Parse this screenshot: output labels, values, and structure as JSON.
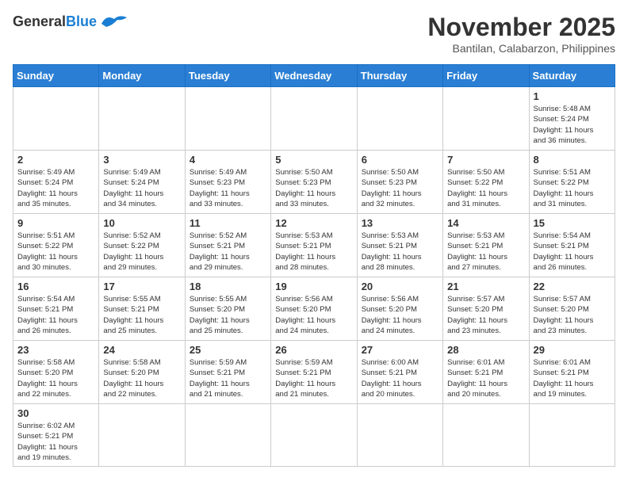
{
  "header": {
    "logo_general": "General",
    "logo_blue": "Blue",
    "month_title": "November 2025",
    "location": "Bantilan, Calabarzon, Philippines"
  },
  "days_of_week": [
    "Sunday",
    "Monday",
    "Tuesday",
    "Wednesday",
    "Thursday",
    "Friday",
    "Saturday"
  ],
  "weeks": [
    [
      {
        "day": "",
        "info": ""
      },
      {
        "day": "",
        "info": ""
      },
      {
        "day": "",
        "info": ""
      },
      {
        "day": "",
        "info": ""
      },
      {
        "day": "",
        "info": ""
      },
      {
        "day": "",
        "info": ""
      },
      {
        "day": "1",
        "info": "Sunrise: 5:48 AM\nSunset: 5:24 PM\nDaylight: 11 hours\nand 36 minutes."
      }
    ],
    [
      {
        "day": "2",
        "info": "Sunrise: 5:49 AM\nSunset: 5:24 PM\nDaylight: 11 hours\nand 35 minutes."
      },
      {
        "day": "3",
        "info": "Sunrise: 5:49 AM\nSunset: 5:24 PM\nDaylight: 11 hours\nand 34 minutes."
      },
      {
        "day": "4",
        "info": "Sunrise: 5:49 AM\nSunset: 5:23 PM\nDaylight: 11 hours\nand 33 minutes."
      },
      {
        "day": "5",
        "info": "Sunrise: 5:50 AM\nSunset: 5:23 PM\nDaylight: 11 hours\nand 33 minutes."
      },
      {
        "day": "6",
        "info": "Sunrise: 5:50 AM\nSunset: 5:23 PM\nDaylight: 11 hours\nand 32 minutes."
      },
      {
        "day": "7",
        "info": "Sunrise: 5:50 AM\nSunset: 5:22 PM\nDaylight: 11 hours\nand 31 minutes."
      },
      {
        "day": "8",
        "info": "Sunrise: 5:51 AM\nSunset: 5:22 PM\nDaylight: 11 hours\nand 31 minutes."
      }
    ],
    [
      {
        "day": "9",
        "info": "Sunrise: 5:51 AM\nSunset: 5:22 PM\nDaylight: 11 hours\nand 30 minutes."
      },
      {
        "day": "10",
        "info": "Sunrise: 5:52 AM\nSunset: 5:22 PM\nDaylight: 11 hours\nand 29 minutes."
      },
      {
        "day": "11",
        "info": "Sunrise: 5:52 AM\nSunset: 5:21 PM\nDaylight: 11 hours\nand 29 minutes."
      },
      {
        "day": "12",
        "info": "Sunrise: 5:53 AM\nSunset: 5:21 PM\nDaylight: 11 hours\nand 28 minutes."
      },
      {
        "day": "13",
        "info": "Sunrise: 5:53 AM\nSunset: 5:21 PM\nDaylight: 11 hours\nand 28 minutes."
      },
      {
        "day": "14",
        "info": "Sunrise: 5:53 AM\nSunset: 5:21 PM\nDaylight: 11 hours\nand 27 minutes."
      },
      {
        "day": "15",
        "info": "Sunrise: 5:54 AM\nSunset: 5:21 PM\nDaylight: 11 hours\nand 26 minutes."
      }
    ],
    [
      {
        "day": "16",
        "info": "Sunrise: 5:54 AM\nSunset: 5:21 PM\nDaylight: 11 hours\nand 26 minutes."
      },
      {
        "day": "17",
        "info": "Sunrise: 5:55 AM\nSunset: 5:21 PM\nDaylight: 11 hours\nand 25 minutes."
      },
      {
        "day": "18",
        "info": "Sunrise: 5:55 AM\nSunset: 5:20 PM\nDaylight: 11 hours\nand 25 minutes."
      },
      {
        "day": "19",
        "info": "Sunrise: 5:56 AM\nSunset: 5:20 PM\nDaylight: 11 hours\nand 24 minutes."
      },
      {
        "day": "20",
        "info": "Sunrise: 5:56 AM\nSunset: 5:20 PM\nDaylight: 11 hours\nand 24 minutes."
      },
      {
        "day": "21",
        "info": "Sunrise: 5:57 AM\nSunset: 5:20 PM\nDaylight: 11 hours\nand 23 minutes."
      },
      {
        "day": "22",
        "info": "Sunrise: 5:57 AM\nSunset: 5:20 PM\nDaylight: 11 hours\nand 23 minutes."
      }
    ],
    [
      {
        "day": "23",
        "info": "Sunrise: 5:58 AM\nSunset: 5:20 PM\nDaylight: 11 hours\nand 22 minutes."
      },
      {
        "day": "24",
        "info": "Sunrise: 5:58 AM\nSunset: 5:20 PM\nDaylight: 11 hours\nand 22 minutes."
      },
      {
        "day": "25",
        "info": "Sunrise: 5:59 AM\nSunset: 5:21 PM\nDaylight: 11 hours\nand 21 minutes."
      },
      {
        "day": "26",
        "info": "Sunrise: 5:59 AM\nSunset: 5:21 PM\nDaylight: 11 hours\nand 21 minutes."
      },
      {
        "day": "27",
        "info": "Sunrise: 6:00 AM\nSunset: 5:21 PM\nDaylight: 11 hours\nand 20 minutes."
      },
      {
        "day": "28",
        "info": "Sunrise: 6:01 AM\nSunset: 5:21 PM\nDaylight: 11 hours\nand 20 minutes."
      },
      {
        "day": "29",
        "info": "Sunrise: 6:01 AM\nSunset: 5:21 PM\nDaylight: 11 hours\nand 19 minutes."
      }
    ],
    [
      {
        "day": "30",
        "info": "Sunrise: 6:02 AM\nSunset: 5:21 PM\nDaylight: 11 hours\nand 19 minutes."
      },
      {
        "day": "",
        "info": ""
      },
      {
        "day": "",
        "info": ""
      },
      {
        "day": "",
        "info": ""
      },
      {
        "day": "",
        "info": ""
      },
      {
        "day": "",
        "info": ""
      },
      {
        "day": "",
        "info": ""
      }
    ]
  ]
}
